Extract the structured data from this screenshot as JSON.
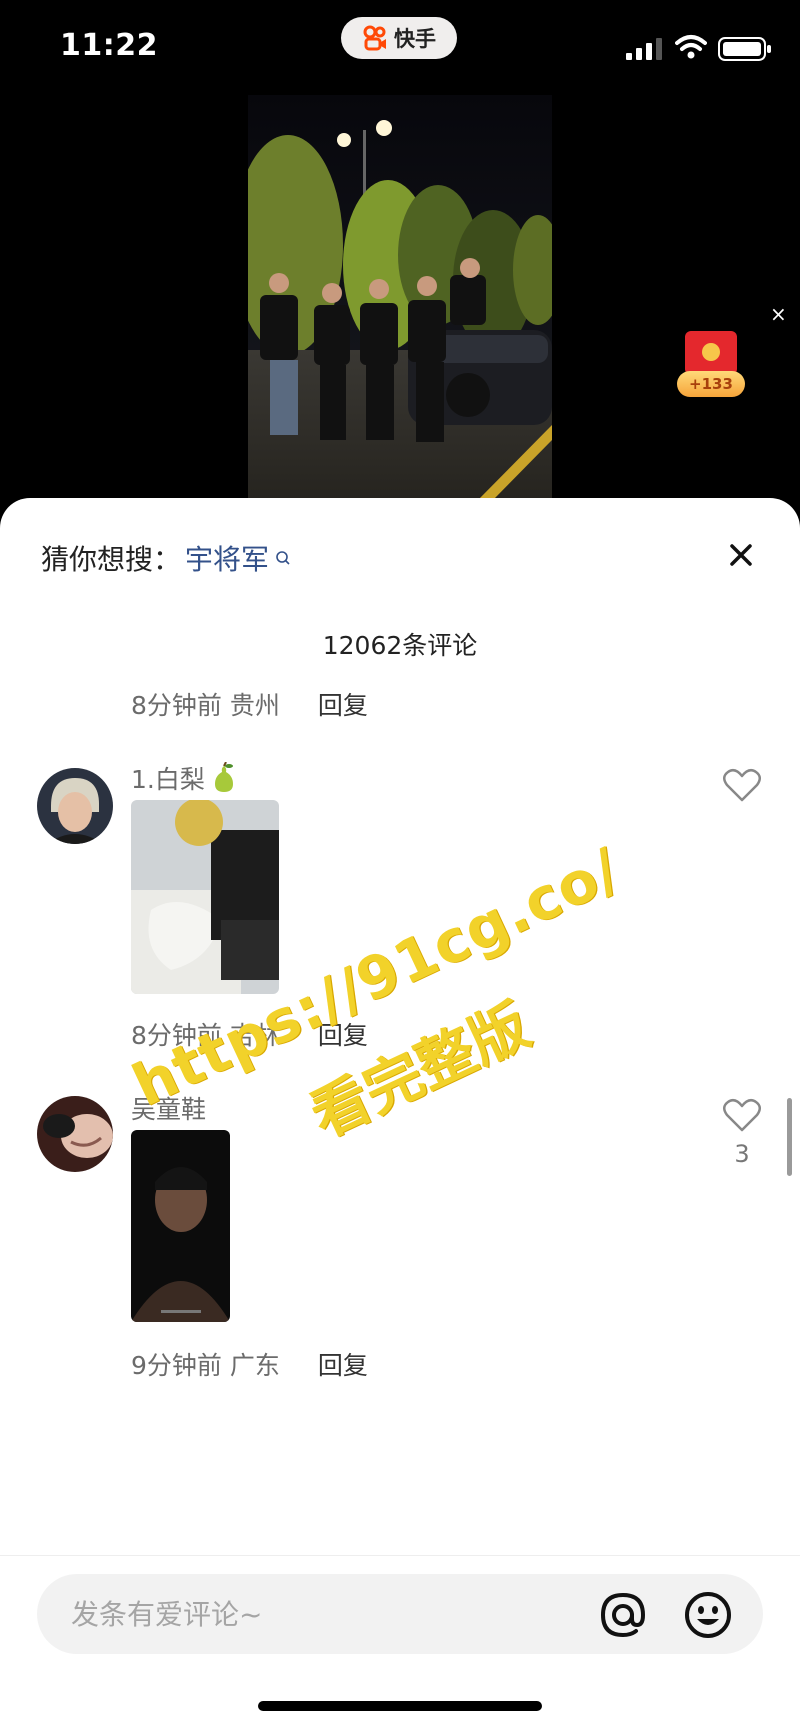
{
  "status_bar": {
    "time": "11:22",
    "app_name": "快手"
  },
  "video": {
    "red_packet_badge": "+133",
    "close_glyph": "×"
  },
  "comments_sheet": {
    "suggest_label": "猜你想搜：",
    "suggest_keyword": "宇将军",
    "comment_count": "12062条评论",
    "top_partial_meta": {
      "time": "8分钟前",
      "location": "贵州",
      "reply": "回复"
    },
    "comments": [
      {
        "username": "1.白梨",
        "time": "8分钟前",
        "location": "吉林",
        "reply": "回复",
        "likes": ""
      },
      {
        "username": "吴童鞋",
        "time": "9分钟前",
        "location": "广东",
        "reply": "回复",
        "likes": "3"
      }
    ]
  },
  "watermark": {
    "line1": "https://91cg.co/",
    "line2": "看完整版"
  },
  "input_bar": {
    "placeholder": "发条有爱评论~"
  },
  "icons": [
    "kuaishou-logo-icon",
    "signal-icon",
    "wifi-icon",
    "battery-icon",
    "search-icon",
    "close-icon",
    "heart-icon",
    "at-icon",
    "emoji-icon",
    "pear-emoji-icon"
  ],
  "colors": {
    "keyword": "#33518a",
    "watermark": "#f2d22a",
    "red_packet": "#e4282d"
  }
}
